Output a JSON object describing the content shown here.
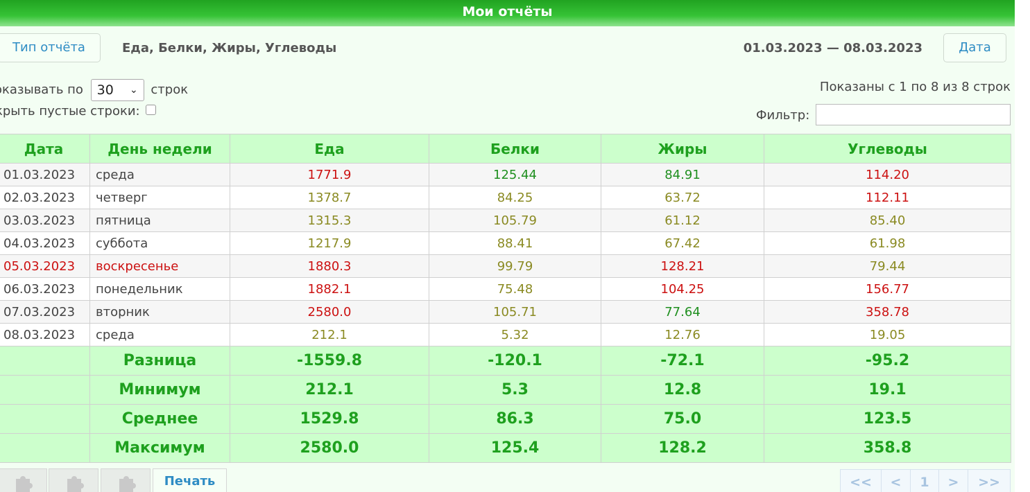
{
  "title": "Мои отчёты",
  "toolbar": {
    "report_type_label": "Тип отчёта",
    "report_description": "Еда, Белки, Жиры, Углеводы",
    "date_range": "01.03.2023 — 08.03.2023",
    "date_button_label": "Дата"
  },
  "controls": {
    "show_prefix": "оказывать по",
    "rows_per_page": "30",
    "show_suffix": "строк",
    "hide_empty_label": "крыть пустые строки:",
    "hide_empty_checked": false,
    "shown_info": "Показаны с 1 по 8 из 8 строк",
    "filter_label": "Фильтр:",
    "filter_value": ""
  },
  "table": {
    "headers": [
      "Дата",
      "День недели",
      "Еда",
      "Белки",
      "Жиры",
      "Углеводы"
    ],
    "rows": [
      {
        "date": "01.03.2023",
        "day": "среда",
        "food": "1771.9",
        "protein": "125.44",
        "fat": "84.91",
        "carbs": "114.20"
      },
      {
        "date": "02.03.2023",
        "day": "четверг",
        "food": "1378.7",
        "protein": "84.25",
        "fat": "63.72",
        "carbs": "112.11"
      },
      {
        "date": "03.03.2023",
        "day": "пятница",
        "food": "1315.3",
        "protein": "105.79",
        "fat": "61.12",
        "carbs": "85.40"
      },
      {
        "date": "04.03.2023",
        "day": "суббота",
        "food": "1217.9",
        "protein": "88.41",
        "fat": "67.42",
        "carbs": "61.98"
      },
      {
        "date": "05.03.2023",
        "day": "воскресенье",
        "food": "1880.3",
        "protein": "99.79",
        "fat": "128.21",
        "carbs": "79.44"
      },
      {
        "date": "06.03.2023",
        "day": "понедельник",
        "food": "1882.1",
        "protein": "75.48",
        "fat": "104.25",
        "carbs": "156.77"
      },
      {
        "date": "07.03.2023",
        "day": "вторник",
        "food": "2580.0",
        "protein": "105.71",
        "fat": "77.64",
        "carbs": "358.78"
      },
      {
        "date": "08.03.2023",
        "day": "среда",
        "food": "212.1",
        "protein": "5.32",
        "fat": "12.76",
        "carbs": "19.05"
      }
    ],
    "summary": [
      {
        "label": "Разница",
        "food": "-1559.8",
        "protein": "-120.1",
        "fat": "-72.1",
        "carbs": "-95.2"
      },
      {
        "label": "Минимум",
        "food": "212.1",
        "protein": "5.3",
        "fat": "12.8",
        "carbs": "19.1"
      },
      {
        "label": "Среднее",
        "food": "1529.8",
        "protein": "86.3",
        "fat": "75.0",
        "carbs": "123.5"
      },
      {
        "label": "Максимум",
        "food": "2580.0",
        "protein": "125.4",
        "fat": "128.2",
        "carbs": "358.8"
      }
    ]
  },
  "value_colors": {
    "red": "#cc1111",
    "olive": "#8a8a22",
    "green": "#1f8f1f"
  },
  "bottom": {
    "plugin_icons": [
      "puzzle-icon",
      "puzzle-icon",
      "puzzle-icon"
    ],
    "print_label": "Печать",
    "pager": [
      "<<",
      "<",
      "1",
      ">",
      ">>"
    ]
  }
}
